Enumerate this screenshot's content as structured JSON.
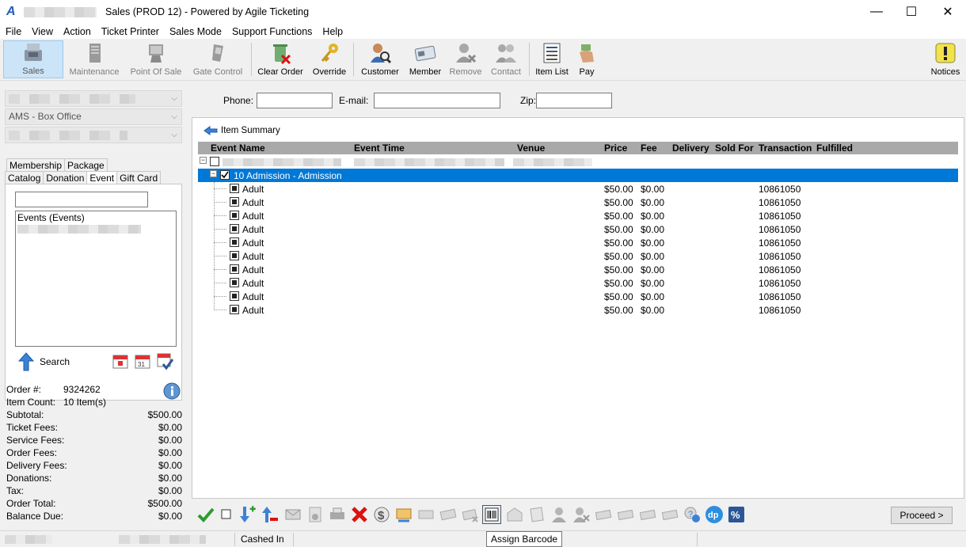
{
  "window": {
    "title": "Sales (PROD 12) - Powered by Agile Ticketing",
    "logo": "A",
    "minimize": "—",
    "maximize": "☐",
    "close": "✕"
  },
  "menu": [
    "File",
    "View",
    "Action",
    "Ticket Printer",
    "Sales Mode",
    "Support Functions",
    "Help"
  ],
  "toolbar": {
    "sales": "Sales",
    "maintenance": "Maintenance",
    "point_of_sale": "Point Of Sale",
    "gate_control": "Gate Control",
    "clear_order": "Clear Order",
    "override": "Override",
    "customer": "Customer",
    "member": "Member",
    "remove": "Remove",
    "contact": "Contact",
    "item_list": "Item List",
    "pay": "Pay",
    "notices": "Notices"
  },
  "left": {
    "combo_box_office": "AMS - Box Office",
    "tabs_row1": [
      "Membership",
      "Package"
    ],
    "tabs_row2": [
      "Catalog",
      "Donation",
      "Event",
      "Gift Card"
    ],
    "events_header": "Events  (Events)",
    "search_label": "Search"
  },
  "order_summary": {
    "order_label": "Order #:",
    "order_number": "9324262",
    "item_count_label": "Item Count:",
    "item_count": "10 Item(s)",
    "rows": [
      {
        "label": "Subtotal:",
        "value": "$500.00"
      },
      {
        "label": "Ticket Fees:",
        "value": "$0.00"
      },
      {
        "label": "Service Fees:",
        "value": "$0.00"
      },
      {
        "label": "Order Fees:",
        "value": "$0.00"
      },
      {
        "label": "Delivery Fees:",
        "value": "$0.00"
      },
      {
        "label": "Donations:",
        "value": "$0.00"
      },
      {
        "label": "Tax:",
        "value": "$0.00"
      },
      {
        "label": "Order Total:",
        "value": "$500.00"
      },
      {
        "label": "Balance Due:",
        "value": "$0.00"
      }
    ]
  },
  "contact": {
    "phone_label": "Phone:",
    "email_label": "E-mail:",
    "zip_label": "Zip:"
  },
  "item_summary": {
    "title": "Item Summary",
    "columns": {
      "event_name": "Event Name",
      "event_time": "Event Time",
      "venue": "Venue",
      "price": "Price",
      "fee": "Fee",
      "delivery": "Delivery",
      "sold_for": "Sold For",
      "transaction": "Transaction",
      "fulfilled": "Fulfilled"
    },
    "group_label": "10 Admission - Admission",
    "items": [
      {
        "name": "Adult",
        "price": "$50.00",
        "fee": "$0.00",
        "transaction": "10861050"
      },
      {
        "name": "Adult",
        "price": "$50.00",
        "fee": "$0.00",
        "transaction": "10861050"
      },
      {
        "name": "Adult",
        "price": "$50.00",
        "fee": "$0.00",
        "transaction": "10861050"
      },
      {
        "name": "Adult",
        "price": "$50.00",
        "fee": "$0.00",
        "transaction": "10861050"
      },
      {
        "name": "Adult",
        "price": "$50.00",
        "fee": "$0.00",
        "transaction": "10861050"
      },
      {
        "name": "Adult",
        "price": "$50.00",
        "fee": "$0.00",
        "transaction": "10861050"
      },
      {
        "name": "Adult",
        "price": "$50.00",
        "fee": "$0.00",
        "transaction": "10861050"
      },
      {
        "name": "Adult",
        "price": "$50.00",
        "fee": "$0.00",
        "transaction": "10861050"
      },
      {
        "name": "Adult",
        "price": "$50.00",
        "fee": "$0.00",
        "transaction": "10861050"
      },
      {
        "name": "Adult",
        "price": "$50.00",
        "fee": "$0.00",
        "transaction": "10861050"
      }
    ]
  },
  "actions": {
    "proceed": "Proceed >",
    "tooltip": "Assign Barcode"
  },
  "status": {
    "cashed_in": "Cashed In"
  },
  "colors": {
    "selection": "#0078d7",
    "grid_header": "#a9a9a9",
    "active_tool": "#cce4f7"
  }
}
